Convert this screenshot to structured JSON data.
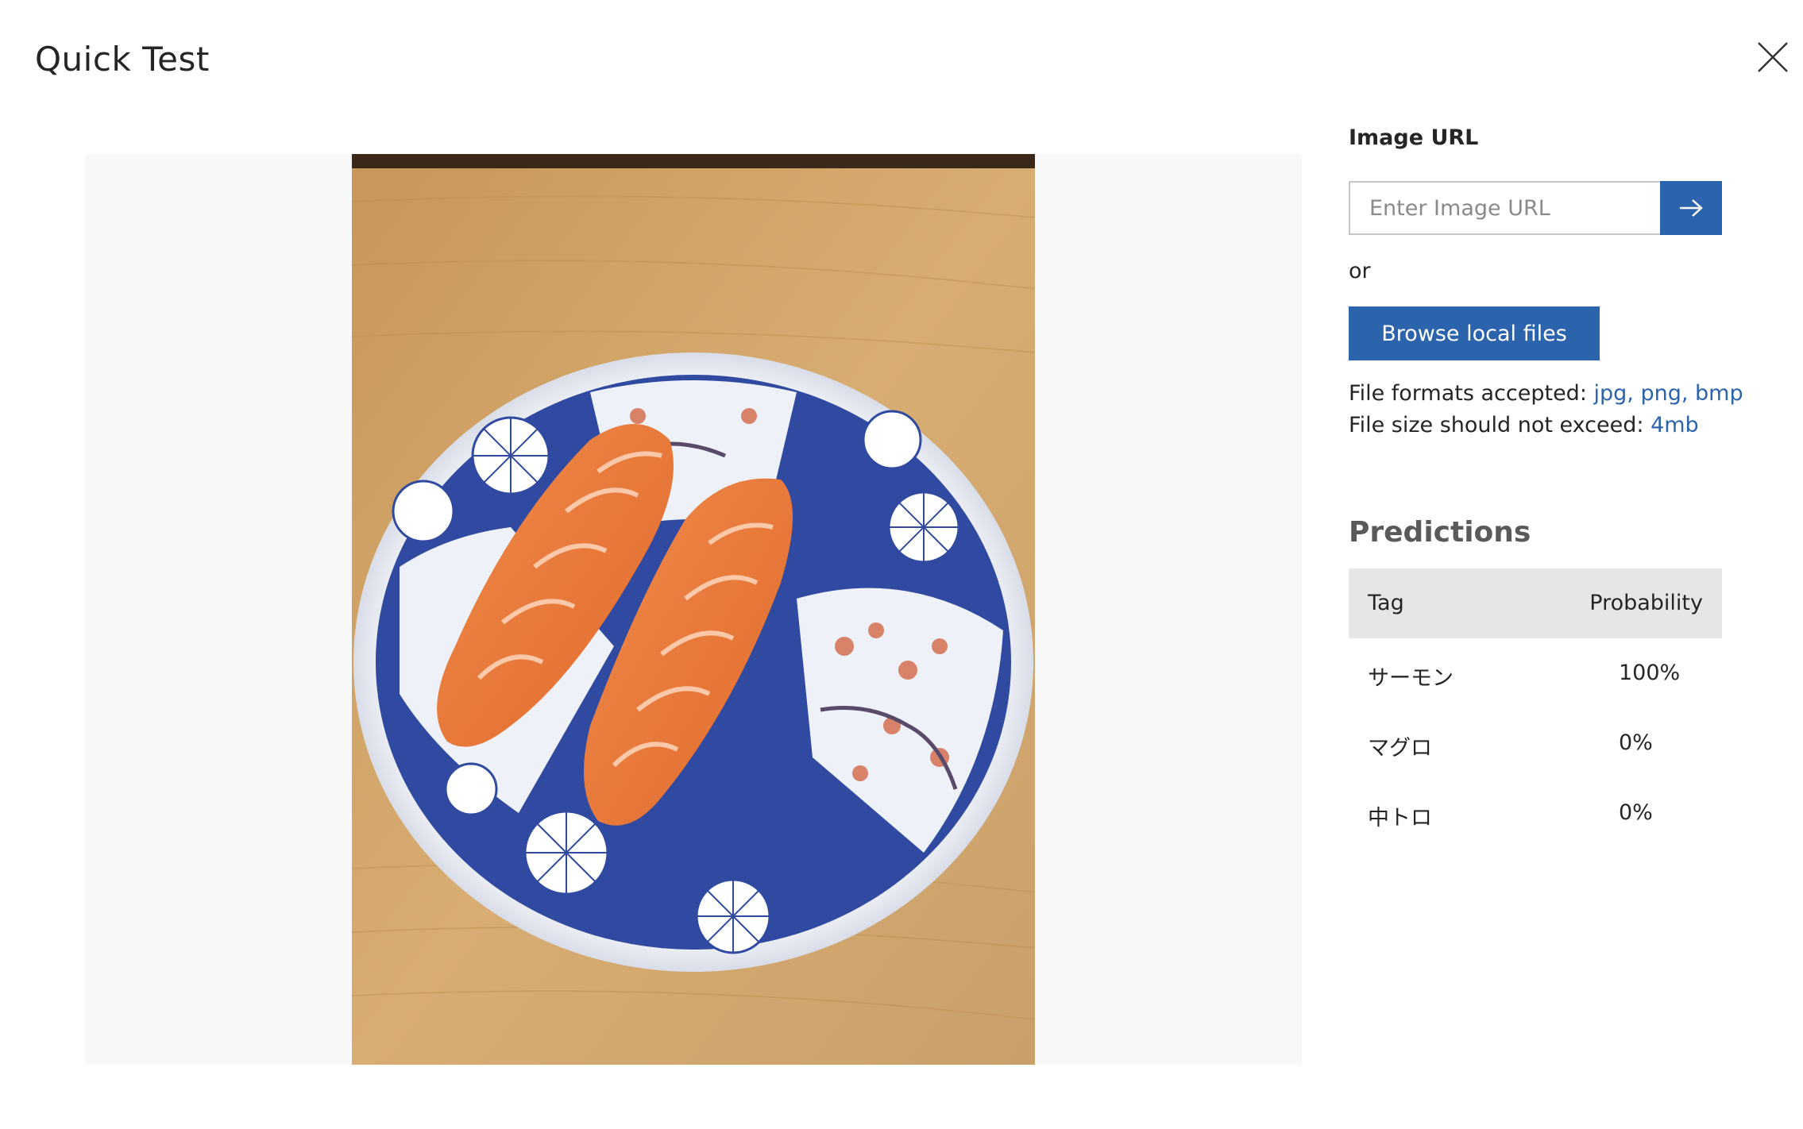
{
  "dialog": {
    "title": "Quick Test",
    "close_icon": "close-icon"
  },
  "preview": {
    "image_subject": "salmon nigiri sushi on blue and white plate"
  },
  "upload": {
    "url_label": "Image URL",
    "url_placeholder": "Enter Image URL",
    "url_value": "",
    "submit_icon": "arrow-right-icon",
    "or_text": "or",
    "browse_label": "Browse local files",
    "formats_prefix": "File formats accepted: ",
    "formats_value": "jpg, png, bmp",
    "size_prefix": "File size should not exceed: ",
    "size_value": "4mb"
  },
  "predictions": {
    "title": "Predictions",
    "columns": [
      "Tag",
      "Probability"
    ],
    "rows": [
      {
        "tag": "サーモン",
        "probability": "100%"
      },
      {
        "tag": "マグロ",
        "probability": "0%"
      },
      {
        "tag": "中トロ",
        "probability": "0%"
      }
    ]
  },
  "colors": {
    "accent": "#2b64ad",
    "header_bg": "#e6e6e6",
    "preview_bg": "#f8f8f8"
  }
}
